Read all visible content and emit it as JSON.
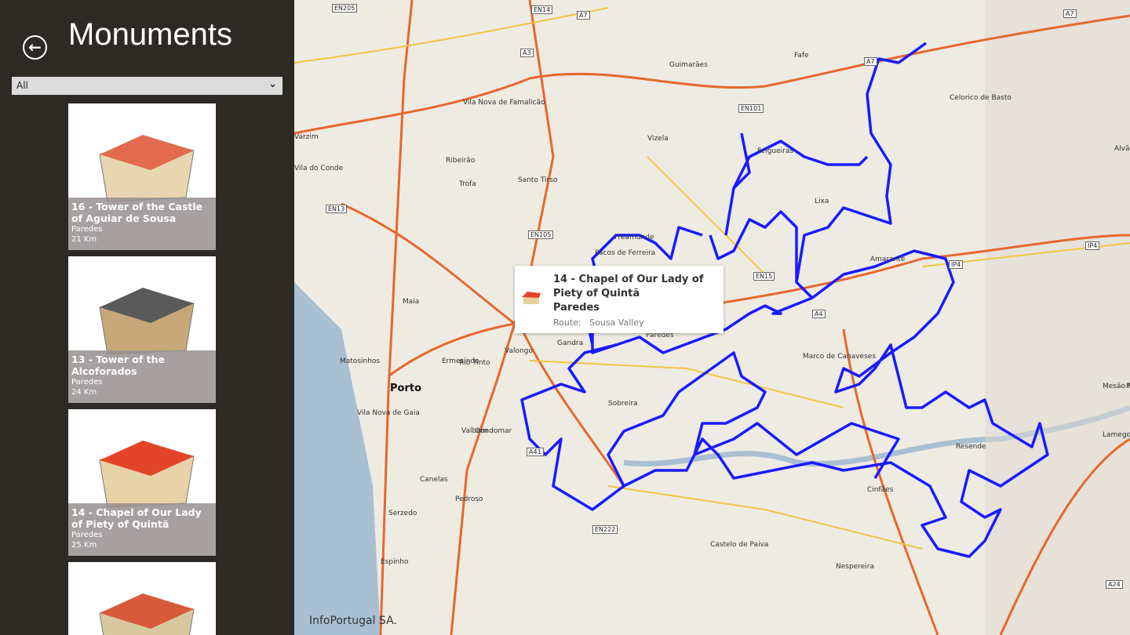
{
  "sidebar": {
    "title": "Monuments",
    "back_icon": "arrow-left-circle-icon",
    "filter": {
      "selected": "All"
    },
    "items": [
      {
        "name": "16 - Tower of the Castle of Aguiar de Sousa",
        "place": "Paredes",
        "distance": "21 Km"
      },
      {
        "name": "13 - Tower of the Alcoforados",
        "place": "Paredes",
        "distance": "24 Km"
      },
      {
        "name": "14 - Chapel of Our Lady of Piety of Quintã",
        "place": "Paredes",
        "distance": "25 Km"
      },
      {
        "name": "",
        "place": "",
        "distance": ""
      }
    ]
  },
  "map": {
    "attribution": "InfoPortugal SA.",
    "route_color": "#1a1aff",
    "places": [
      "Porto",
      "Maia",
      "Matosinhos",
      "Vila Nova de Gaia",
      "Gondomar",
      "Valongo",
      "Ermesinde",
      "Rio Tinto",
      "Paredes",
      "Guimarães",
      "Fafe",
      "Felgueiras",
      "Vizela",
      "Santo Tirso",
      "Trofa",
      "Vila Nova de Famalicão",
      "Pacos de Ferreira",
      "Freamunde",
      "Lixa",
      "Amarante",
      "Marco de Canaveses",
      "Resende",
      "Lamego",
      "Mesão Frio",
      "Peso da Régua",
      "Castelo de Paiva",
      "Espinho",
      "Alvão",
      "Cinfães",
      "Valbom",
      "Ribeirão",
      "Celorico de Basto",
      "Varzim",
      "Vila do Conde",
      "Gandra",
      "Sobreira",
      "Pedroso",
      "Serzedo",
      "Canelas",
      "Nespereira"
    ],
    "roads": [
      "EN205",
      "EN14",
      "A7",
      "A3",
      "EN101",
      "EN13",
      "EN105",
      "EN15",
      "A4",
      "A41",
      "EN222",
      "IP4",
      "IP4",
      "A24",
      "A7",
      "A7"
    ],
    "popup": {
      "title": "14 - Chapel of Our Lady of Piety of Quintã",
      "place": "Paredes",
      "route_label": "Route:",
      "route": "Sousa Valley"
    }
  }
}
